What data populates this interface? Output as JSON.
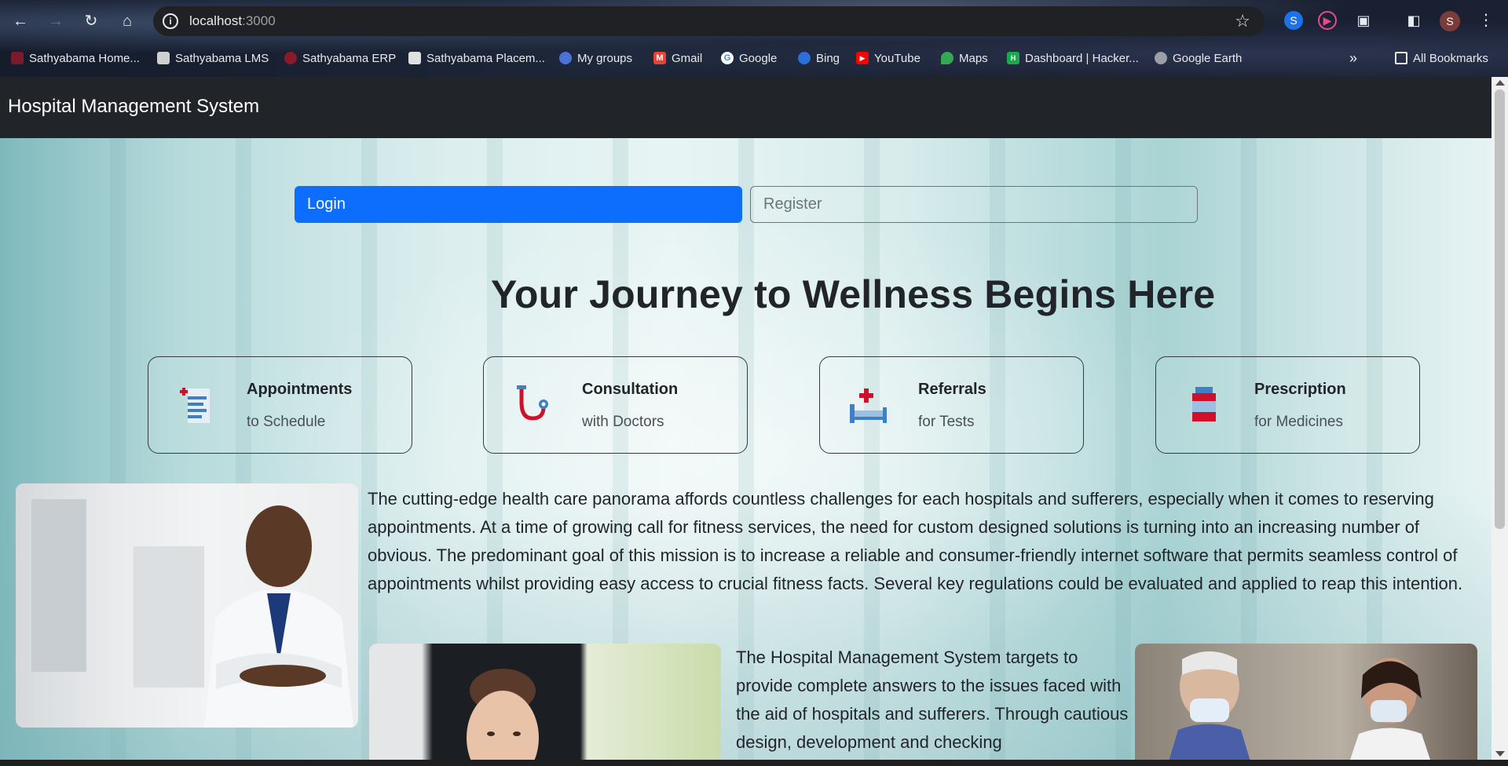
{
  "browser": {
    "url_host": "localhost",
    "url_port": ":3000",
    "avatar_letter": "S",
    "bookmarks": [
      {
        "label": "Sathyabama Home...",
        "icon": "sathyabama-icon"
      },
      {
        "label": "Sathyabama LMS",
        "icon": "lms-icon"
      },
      {
        "label": "Sathyabama ERP",
        "icon": "erp-icon"
      },
      {
        "label": "Sathyabama Placem...",
        "icon": "placement-icon"
      },
      {
        "label": "My groups",
        "icon": "groups-icon"
      },
      {
        "label": "Gmail",
        "icon": "gmail-icon"
      },
      {
        "label": "Google",
        "icon": "google-icon"
      },
      {
        "label": "Bing",
        "icon": "bing-icon"
      },
      {
        "label": "YouTube",
        "icon": "youtube-icon"
      },
      {
        "label": "Maps",
        "icon": "maps-icon"
      },
      {
        "label": "Dashboard | Hacker...",
        "icon": "hackerrank-icon"
      },
      {
        "label": "Google Earth",
        "icon": "earth-icon"
      }
    ],
    "all_bookmarks": "All Bookmarks"
  },
  "app": {
    "brand": "Hospital Management System",
    "login_label": "Login",
    "register_label": "Register",
    "headline": "Your Journey to Wellness Begins Here",
    "cards": [
      {
        "title": "Appointments",
        "subtitle": "to Schedule",
        "icon": "appointment-list-icon"
      },
      {
        "title": "Consultation",
        "subtitle": "with Doctors",
        "icon": "stethoscope-icon"
      },
      {
        "title": "Referrals",
        "subtitle": "for Tests",
        "icon": "hospital-bed-icon"
      },
      {
        "title": "Prescription",
        "subtitle": "for Medicines",
        "icon": "medicine-bottle-icon"
      }
    ],
    "paragraph1": "The cutting-edge health care panorama affords countless challenges for each hospitals and sufferers, especially when it comes to reserving appointments. At a time of growing call for fitness services, the need for custom designed solutions is turning into an increasing number of obvious. The predominant goal of this mission is to increase a reliable and consumer-friendly internet software that permits seamless control of appointments whilst providing easy access to crucial fitness facts. Several key regulations could be evaluated and applied to reap this intention.",
    "paragraph2": "The Hospital Management System targets to provide complete answers to the issues faced with the aid of hospitals and sufferers. Through cautious design, development and checking"
  },
  "colors": {
    "primary": "#0d6efd",
    "navbar": "#212529",
    "secondary": "#6c757d"
  }
}
